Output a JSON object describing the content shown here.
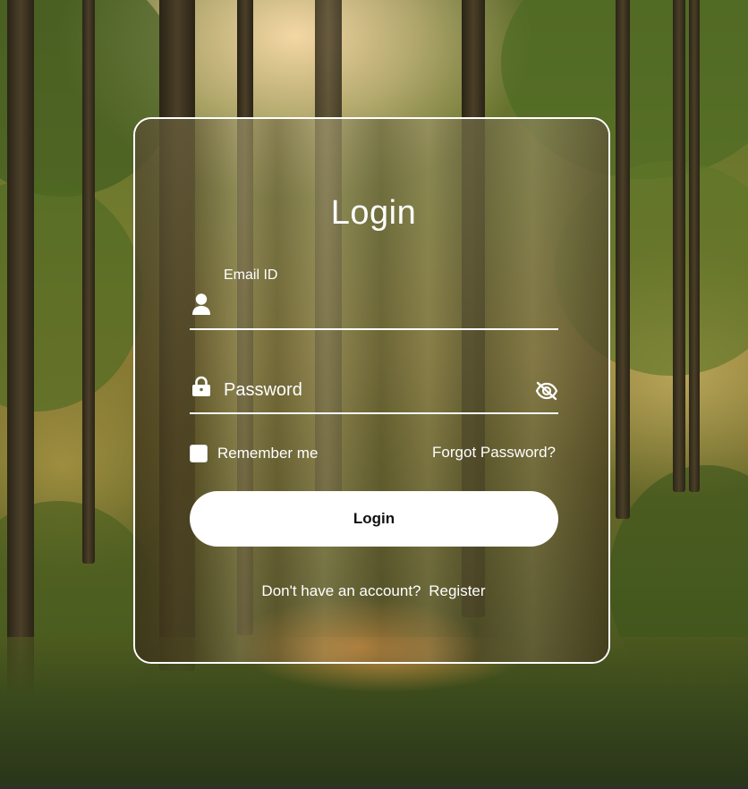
{
  "form": {
    "title": "Login",
    "email": {
      "label": "Email ID",
      "value": ""
    },
    "password": {
      "placeholder": "Password",
      "value": ""
    },
    "remember_label": "Remember me",
    "remember_checked": false,
    "forgot_label": "Forgot Password?",
    "submit_label": "Login",
    "register_prompt": "Don't have an account?",
    "register_label": "Register"
  },
  "icons": {
    "email": "user-icon",
    "password": "lock-icon",
    "visibility": "eye-slash-icon"
  },
  "colors": {
    "text": "#ffffff",
    "button_bg": "#ffffff",
    "button_text": "#111111",
    "card_border": "#ffffff"
  }
}
